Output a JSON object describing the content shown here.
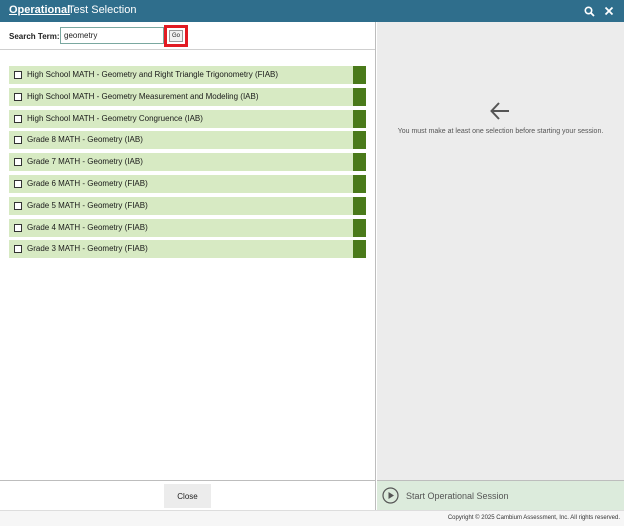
{
  "header": {
    "mode": "Operational",
    "title": "Test Selection",
    "icons": [
      "search-icon",
      "close-icon"
    ],
    "color": "#2f6e8c"
  },
  "search": {
    "label": "Search Term:",
    "value": "geometry",
    "go_label": "Go"
  },
  "tests": [
    {
      "label": "High School MATH - Geometry and Right Triangle Trigonometry (FIAB)"
    },
    {
      "label": "High School MATH - Geometry Measurement and Modeling (IAB)"
    },
    {
      "label": "High School MATH - Geometry Congruence (IAB)"
    },
    {
      "label": "Grade 8 MATH - Geometry (IAB)"
    },
    {
      "label": "Grade 7 MATH - Geometry (IAB)"
    },
    {
      "label": "Grade 6 MATH - Geometry (FIAB)"
    },
    {
      "label": "Grade 5 MATH - Geometry (FIAB)"
    },
    {
      "label": "Grade 4 MATH - Geometry (FIAB)"
    },
    {
      "label": "Grade 3 MATH - Geometry (FIAB)"
    }
  ],
  "right_panel": {
    "message": "You must make at least one selection before starting your session.",
    "icon": "arrow-left-icon"
  },
  "footer": {
    "close_label": "Close",
    "start_label": "Start Operational Session",
    "start_icon": "play-icon",
    "copyright": "Copyright © 2025 Cambium Assessment, Inc. All rights reserved."
  },
  "colors": {
    "item_bg": "#d7eac3",
    "item_accent": "#4a7a1a",
    "highlight": "#e21b23"
  }
}
